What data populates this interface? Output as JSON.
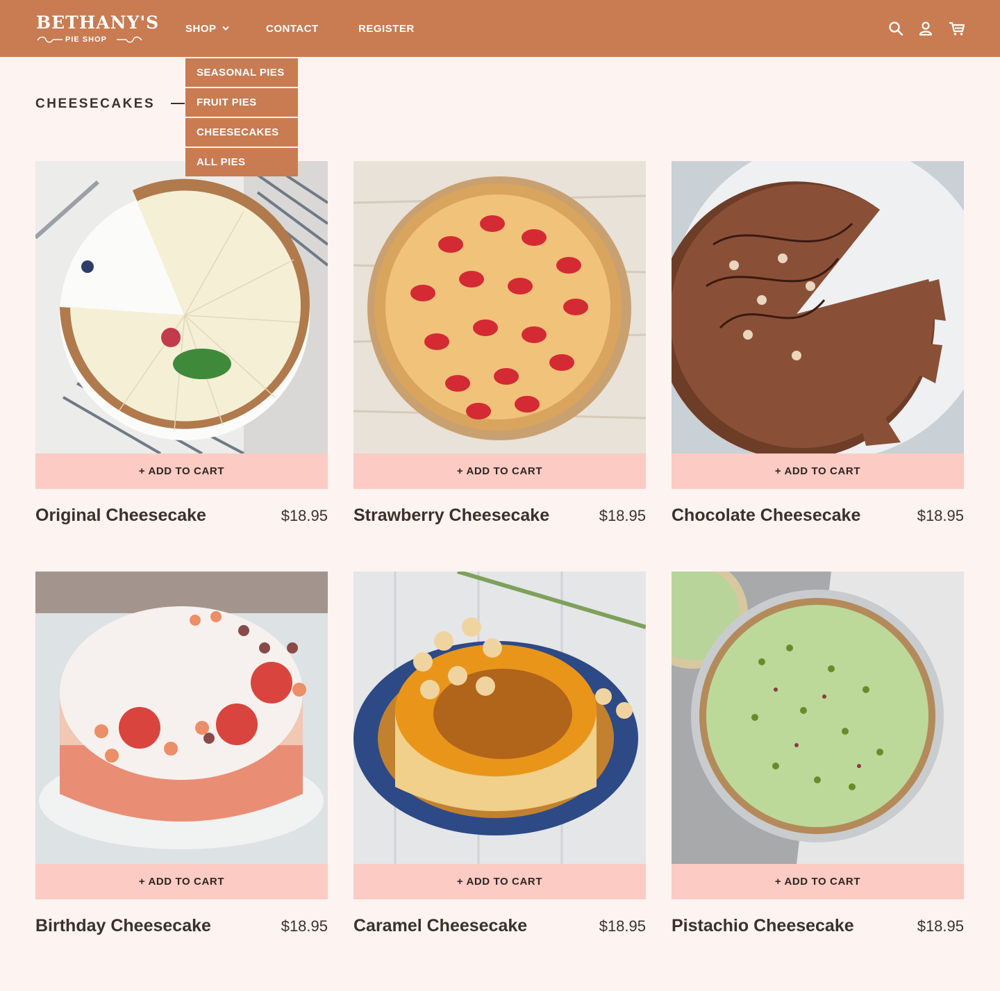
{
  "brand": {
    "name": "BETHANY'S",
    "tagline": "PIE SHOP"
  },
  "nav": {
    "shop": "SHOP",
    "contact": "CONTACT",
    "register": "REGISTER"
  },
  "dropdown": [
    "SEASONAL PIES",
    "FRUIT PIES",
    "CHEESECAKES",
    "ALL PIES"
  ],
  "icons": [
    "search-icon",
    "user-icon",
    "cart-icon",
    "chevron-down-icon"
  ],
  "page": {
    "title": "CHEESECAKES"
  },
  "colors": {
    "header": "#c97b52",
    "background": "#fdf3f1",
    "button": "#fccbc4",
    "text": "#3a312c"
  },
  "products": [
    {
      "name": "Original Cheesecake",
      "price": "$18.95",
      "button": "+ ADD TO CART"
    },
    {
      "name": "Strawberry Cheesecake",
      "price": "$18.95",
      "button": "+ ADD TO CART"
    },
    {
      "name": "Chocolate Cheesecake",
      "price": "$18.95",
      "button": "+ ADD TO CART"
    },
    {
      "name": "Birthday Cheesecake",
      "price": "$18.95",
      "button": "+ ADD TO CART"
    },
    {
      "name": "Caramel Cheesecake",
      "price": "$18.95",
      "button": "+ ADD TO CART"
    },
    {
      "name": "Pistachio Cheesecake",
      "price": "$18.95",
      "button": "+ ADD TO CART"
    }
  ]
}
